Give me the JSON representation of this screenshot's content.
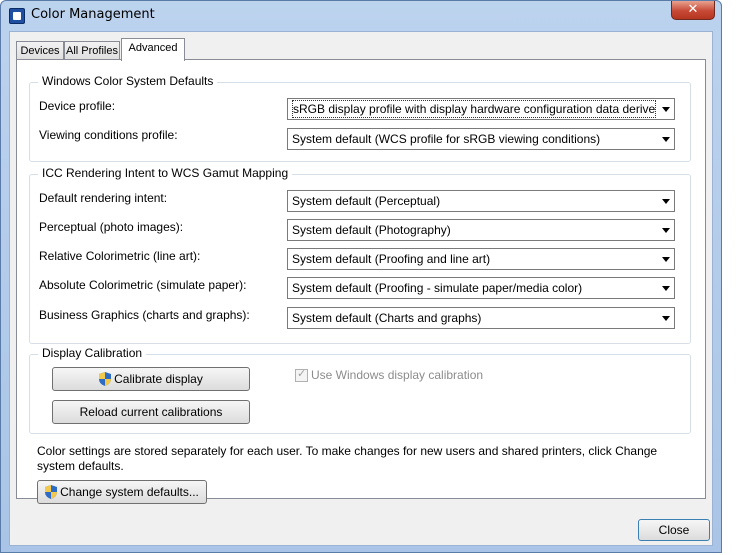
{
  "window": {
    "title": "Color Management",
    "close_glyph": "✕",
    "close_label": "Close"
  },
  "tabs": [
    "Devices",
    "All Profiles",
    "Advanced"
  ],
  "wcs": {
    "legend": "Windows Color System Defaults",
    "device_profile_label": "Device profile:",
    "device_profile_value": "sRGB display profile with display hardware configuration data derived f",
    "viewing_label": "Viewing conditions profile:",
    "viewing_value": "System default (WCS profile for sRGB viewing conditions)"
  },
  "icc": {
    "legend": "ICC Rendering Intent to WCS Gamut Mapping",
    "rows": [
      {
        "label": "Default rendering intent:",
        "value": "System default (Perceptual)"
      },
      {
        "label": "Perceptual (photo images):",
        "value": "System default (Photography)"
      },
      {
        "label": "Relative Colorimetric (line art):",
        "value": "System default (Proofing and line art)"
      },
      {
        "label": "Absolute Colorimetric (simulate paper):",
        "value": "System default (Proofing - simulate paper/media color)"
      },
      {
        "label": "Business Graphics (charts and graphs):",
        "value": "System default (Charts and graphs)"
      }
    ]
  },
  "calibration": {
    "legend": "Display Calibration",
    "calibrate_label": "Calibrate display",
    "reload_label": "Reload current calibrations",
    "use_windows_label": "Use Windows display calibration",
    "use_windows_checked": true
  },
  "info_text": "Color settings are stored separately for each user. To make changes for new users and shared printers, click Change system defaults.",
  "change_defaults_label": "Change system defaults...",
  "icons": {
    "shield": "uac-shield-icon",
    "app": "color-management-icon"
  },
  "colors": {
    "titlebar": "#bcd3ee",
    "close_button": "#c74a36",
    "panel": "#f0f0f0"
  }
}
